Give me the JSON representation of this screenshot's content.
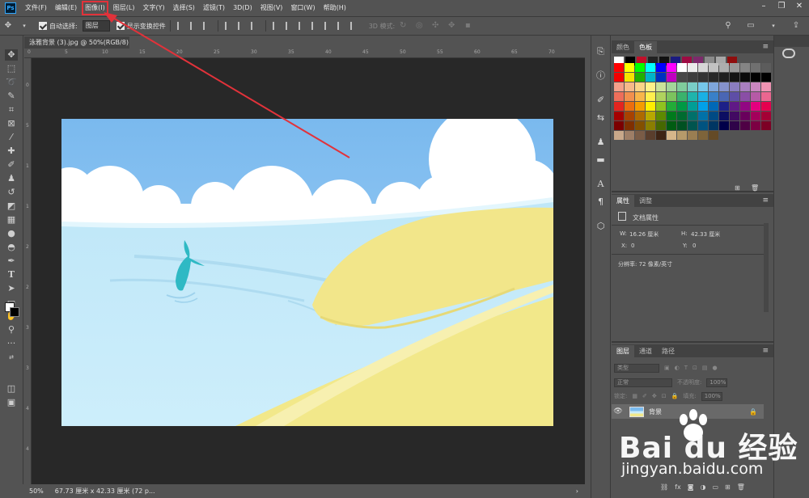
{
  "app": {
    "logo": "Ps"
  },
  "menu": [
    {
      "label": "文件(F)"
    },
    {
      "label": "编辑(E)"
    },
    {
      "label": "图像(I)",
      "highlighted": true
    },
    {
      "label": "图层(L)"
    },
    {
      "label": "文字(Y)"
    },
    {
      "label": "选择(S)"
    },
    {
      "label": "滤镜(T)"
    },
    {
      "label": "3D(D)"
    },
    {
      "label": "视图(V)"
    },
    {
      "label": "窗口(W)"
    },
    {
      "label": "帮助(H)"
    }
  ],
  "options": {
    "auto_select_label": "自动选择:",
    "auto_select_value": "图层",
    "show_transform_label": "显示变换控件",
    "mode_3d_label": "3D 模式:"
  },
  "document": {
    "tab_title": "泳雅背景 (3).jpg @ 50%(RGB/8)",
    "zoom": "50%",
    "size_info": "67.73 厘米 x 42.33 厘米 (72 p..."
  },
  "rulers": {
    "top": [
      "0",
      "5",
      "10",
      "15",
      "20",
      "25",
      "30",
      "35",
      "40",
      "45",
      "50",
      "55",
      "60",
      "65",
      "70"
    ],
    "left": [
      "0",
      "5",
      "1",
      "1",
      "2",
      "2",
      "3",
      "3",
      "4",
      "4"
    ]
  },
  "swatches_panel": {
    "tabs": [
      "颜色",
      "色板"
    ],
    "active_tab": "色板"
  },
  "properties_panel": {
    "tabs": [
      "属性",
      "调整"
    ],
    "active_tab": "属性",
    "header": "文档属性",
    "w_label": "W:",
    "w_value": "16.26 厘米",
    "h_label": "H:",
    "h_value": "42.33 厘米",
    "x_label": "X:",
    "x_value": "0",
    "y_label": "Y:",
    "y_value": "0",
    "resolution": "分辨率: 72 像素/英寸"
  },
  "layers_panel": {
    "tabs": [
      "图层",
      "通道",
      "路径"
    ],
    "active_tab": "图层",
    "filter_placeholder": "类型",
    "blend_mode": "正常",
    "opacity_label": "不透明度:",
    "opacity_value": "100%",
    "lock_label": "锁定:",
    "fill_label": "填充:",
    "fill_value": "100%",
    "layers": [
      {
        "name": "背景",
        "visible": true,
        "locked": true
      }
    ]
  },
  "watermark": {
    "brand": "Bai  du 经验",
    "url": "jingyan.baidu.com"
  },
  "colors": {
    "menu_highlight": "#e2323a",
    "arrow": "#e2323a",
    "ui_bg": "#535353",
    "canvas_bg": "#282828"
  }
}
